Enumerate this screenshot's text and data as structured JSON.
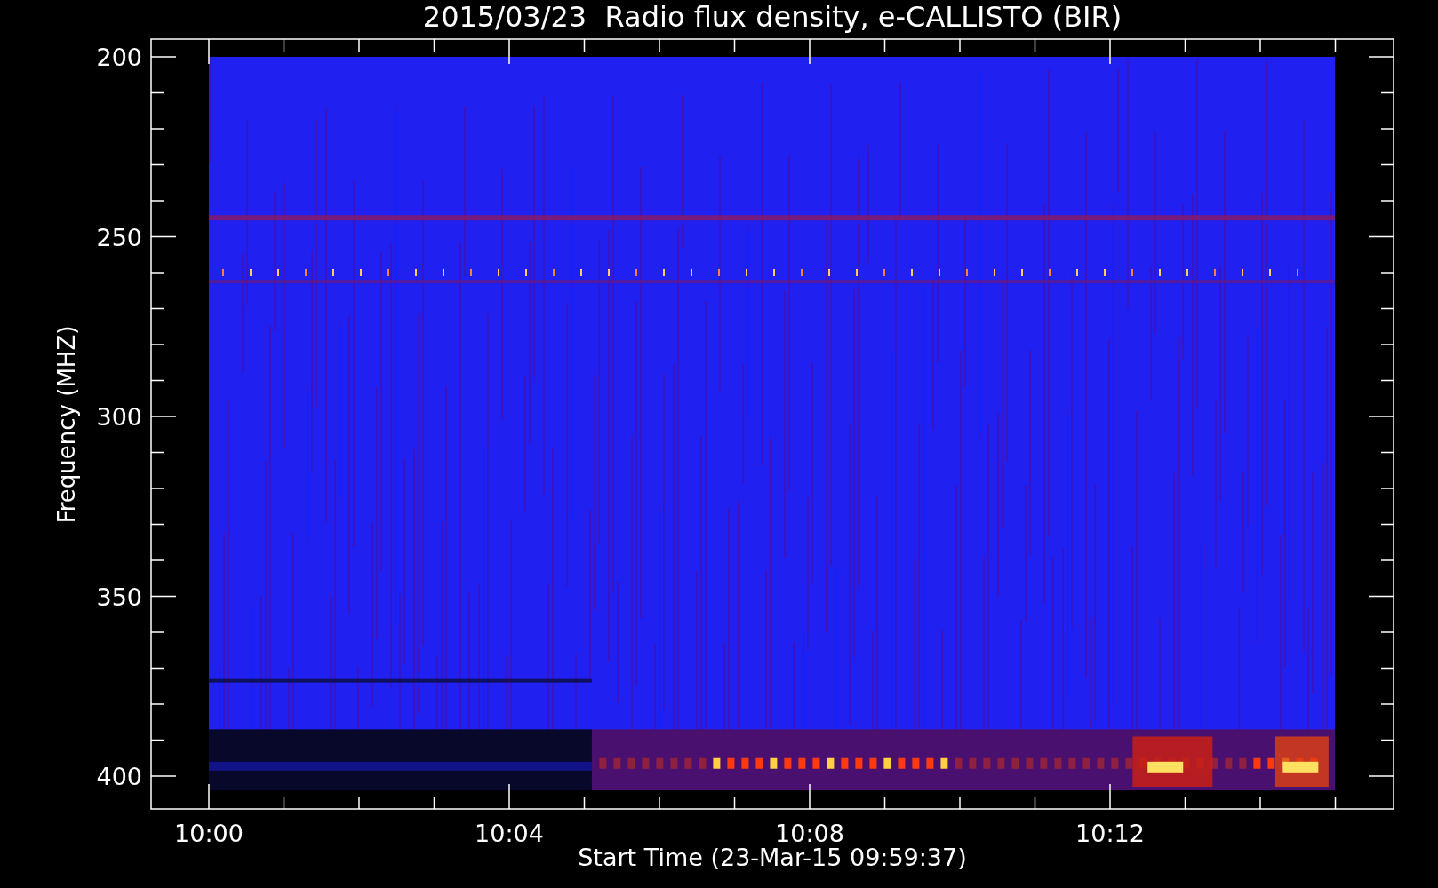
{
  "title": "2015/03/23  Radio flux density, e-CALLISTO (BIR)",
  "y_axis": {
    "label": "Frequency (MHZ)",
    "ticks": [
      "200",
      "250",
      "300",
      "350",
      "400"
    ]
  },
  "x_axis": {
    "label": "Start Time (23-Mar-15 09:59:37)",
    "ticks": [
      "10:00",
      "10:04",
      "10:08",
      "10:12"
    ]
  }
}
